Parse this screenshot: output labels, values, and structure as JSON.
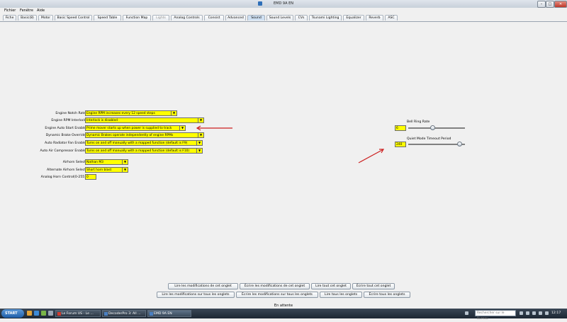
{
  "window": {
    "title": "EMD 9A EN",
    "buttons": {
      "minimize": "–",
      "maximize": "□",
      "close": "✕"
    }
  },
  "menu": [
    "Fichier",
    "Fenêtre",
    "Aide"
  ],
  "tabs": [
    {
      "label": "Fiche",
      "state": "normal"
    },
    {
      "label": "Basic(8)",
      "state": "normal"
    },
    {
      "label": "Motor",
      "state": "normal"
    },
    {
      "label": "Basic Speed Control",
      "state": "normal"
    },
    {
      "label": "Speed Table",
      "state": "normal"
    },
    {
      "label": "Function Map",
      "state": "normal"
    },
    {
      "label": "Lights",
      "state": "disabled"
    },
    {
      "label": "Analog Controls",
      "state": "normal"
    },
    {
      "label": "Consist",
      "state": "normal"
    },
    {
      "label": "Advanced",
      "state": "normal"
    },
    {
      "label": "Sound",
      "state": "active"
    },
    {
      "label": "Sound Levels",
      "state": "normal"
    },
    {
      "label": "CVs",
      "state": "normal"
    },
    {
      "label": "Tsunami Lighting",
      "state": "normal"
    },
    {
      "label": "Equalizer",
      "state": "normal"
    },
    {
      "label": "Reverb",
      "state": "normal"
    },
    {
      "label": "ASC",
      "state": "normal"
    }
  ],
  "settings": [
    {
      "label": "Engine Notch Rate",
      "value": "Engine RPM increases every 12 speed steps"
    },
    {
      "label": "Engine RPM Interlock",
      "value": "Interlock is disabled"
    },
    {
      "label": "Engine Auto Start Enable",
      "value": "Prime mover starts up when power is supplied to track"
    },
    {
      "label": "Dynamic Brake Override",
      "value": "Dynamic Brakes operate independently of engine RPMs"
    },
    {
      "label": "Auto Radiator Fan Enable",
      "value": "Turns on and off manually with a mapped function (default is F9)"
    },
    {
      "label": "Auto Air Compressor Enable",
      "value": "Turns on and off manually with a mapped function (default is F10)"
    }
  ],
  "airhorn": [
    {
      "label": "Airhorn Select",
      "value": "Nathan M3"
    },
    {
      "label": "Alternate Airhorn Select",
      "value": "Short horn blast"
    }
  ],
  "analog_horn": {
    "label": "Analog Horn Control(0-255)",
    "value": "0"
  },
  "sliders": [
    {
      "label": "Bell Ring Rate",
      "value": "6",
      "fraction": 0.42
    },
    {
      "label": "Quiet Mode Timeout Period",
      "value": "240",
      "fraction": 0.94
    }
  ],
  "annotation_color": "#cc1f1f",
  "buttons_row1": [
    "Lire les modifications de cet onglet",
    "Écrire les modifications de cet onglet",
    "Lire tout cet onglet",
    "Écrire tout cet onglet"
  ],
  "buttons_row2": [
    "Lire les modifications sur tous les onglets",
    "Écrire les modifications sur tous les onglets",
    "Lire tous les onglets",
    "Écrire tous les onglets"
  ],
  "status": "En attente",
  "taskbar": {
    "start": "START",
    "tasks": [
      "Le Forum US - Le ...",
      "DecoderPro 3: All ...",
      "EMD 9A EN"
    ],
    "search_placeholder": "Rechercher sur le Bureau",
    "clock": "12:17"
  }
}
